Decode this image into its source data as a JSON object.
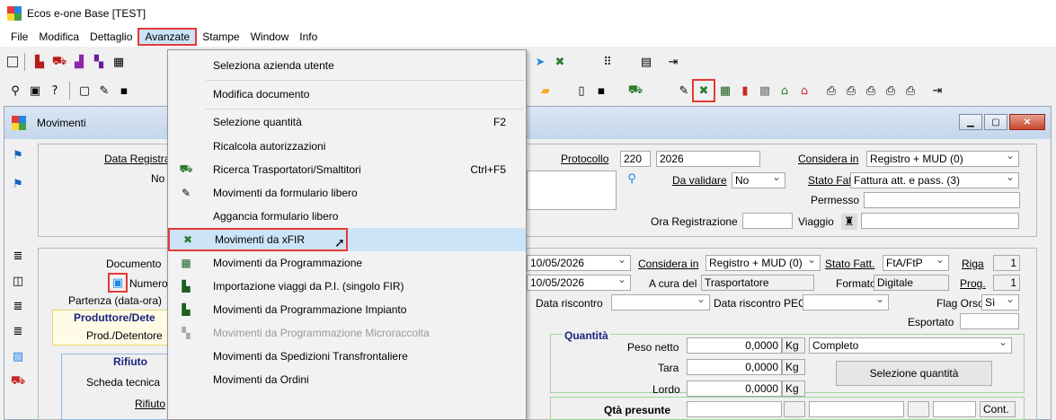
{
  "app": {
    "title": "Ecos e-one Base [TEST]",
    "colors": {
      "red": "#e53935",
      "highlight": "#cce4f7"
    }
  },
  "menubar": [
    "File",
    "Modifica",
    "Dettaglio",
    "Avanzate",
    "Stampe",
    "Window",
    "Info"
  ],
  "mdi": {
    "title": "Movimenti"
  },
  "form": {
    "data_registra": "Data Registra",
    "no": "No",
    "protocollo_label": "Protocollo",
    "protocollo_num": "220",
    "protocollo_year": "2026",
    "considera_in_label": "Considera in",
    "considera_in_top": "Registro + MUD (0)",
    "da_validare_label": "Da validare",
    "da_validare_value": "No",
    "stato_fatt_label": "Stato Fatt.",
    "stato_fatt_top": "Fattura att. e pass. (3)",
    "permesso": "Permesso",
    "ora_registrazione": "Ora Registrazione",
    "viaggio": "Viaggio",
    "documento": "Documento",
    "numero": "Numero",
    "partenza": "Partenza (data-ora)",
    "produttore": "Produttore/Dete",
    "prod_detentore": "Prod./Detentore",
    "rifiuto_hdr": "Rifiuto",
    "scheda_tecnica": "Scheda tecnica",
    "rifiuto": "Rifiuto",
    "date1": "10/05/2026",
    "date2": "10/05/2026",
    "considera_in_mid": "Registro + MUD (0)",
    "stato_fatt_mid": "FtA/FtP",
    "riga_label": "Riga",
    "riga_val": "1",
    "a_cura_label": "A cura del",
    "a_cura_val": "Trasportatore",
    "formato_label": "Formato",
    "formato_val": "Digitale",
    "prog_label": "Prog.",
    "prog_val": "1",
    "data_riscontro": "Data riscontro",
    "data_riscontro_pec": "Data riscontro PEC",
    "flag_orso_label": "Flag Orso",
    "flag_orso_val": "Sì",
    "esportato": "Esportato",
    "quantita": "Quantità",
    "peso_netto": "Peso netto",
    "peso_netto_val": "0,0000",
    "kg": "Kg",
    "completo": "Completo",
    "tara": "Tara",
    "tara_val": "0,0000",
    "lordo": "Lordo",
    "lordo_val": "0,0000",
    "selezione_quantita": "Selezione quantità",
    "qta_presunte": "Qtà presunte",
    "cont": "Cont."
  },
  "menu": {
    "items": [
      {
        "label": "Seleziona azienda utente",
        "shortcut": "",
        "icon": "",
        "disabled": false
      },
      {
        "label": "Modifica documento",
        "shortcut": "",
        "icon": "",
        "disabled": false
      },
      {
        "label": "Selezione quantità",
        "shortcut": "F2",
        "icon": "",
        "disabled": false
      },
      {
        "label": "Ricalcola autorizzazioni",
        "shortcut": "",
        "icon": "",
        "disabled": false
      },
      {
        "label": "Ricerca Trasportatori/Smaltitori",
        "shortcut": "Ctrl+F5",
        "icon": "truck-icon",
        "disabled": false
      },
      {
        "label": "Movimenti da formulario libero",
        "shortcut": "",
        "icon": "edit-form-icon",
        "disabled": false
      },
      {
        "label": "Aggancia formulario libero",
        "shortcut": "",
        "icon": "",
        "disabled": false
      },
      {
        "label": "Movimenti da xFIR",
        "shortcut": "",
        "icon": "xfir-icon",
        "disabled": false
      },
      {
        "label": "Movimenti da Programmazione",
        "shortcut": "",
        "icon": "calendar-icon",
        "disabled": false
      },
      {
        "label": "Importazione viaggi da P.I. (singolo FIR)",
        "shortcut": "",
        "icon": "import-icon",
        "disabled": false
      },
      {
        "label": "Movimenti da Programmazione Impianto",
        "shortcut": "",
        "icon": "plant-icon",
        "disabled": false
      },
      {
        "label": "Movimenti da Programmazione Microraccolta",
        "shortcut": "",
        "icon": "micro-icon",
        "disabled": true
      },
      {
        "label": "Movimenti da Spedizioni Transfrontaliere",
        "shortcut": "",
        "icon": "",
        "disabled": false
      },
      {
        "label": "Movimenti da Ordini",
        "shortcut": "",
        "icon": "",
        "disabled": false
      }
    ]
  }
}
